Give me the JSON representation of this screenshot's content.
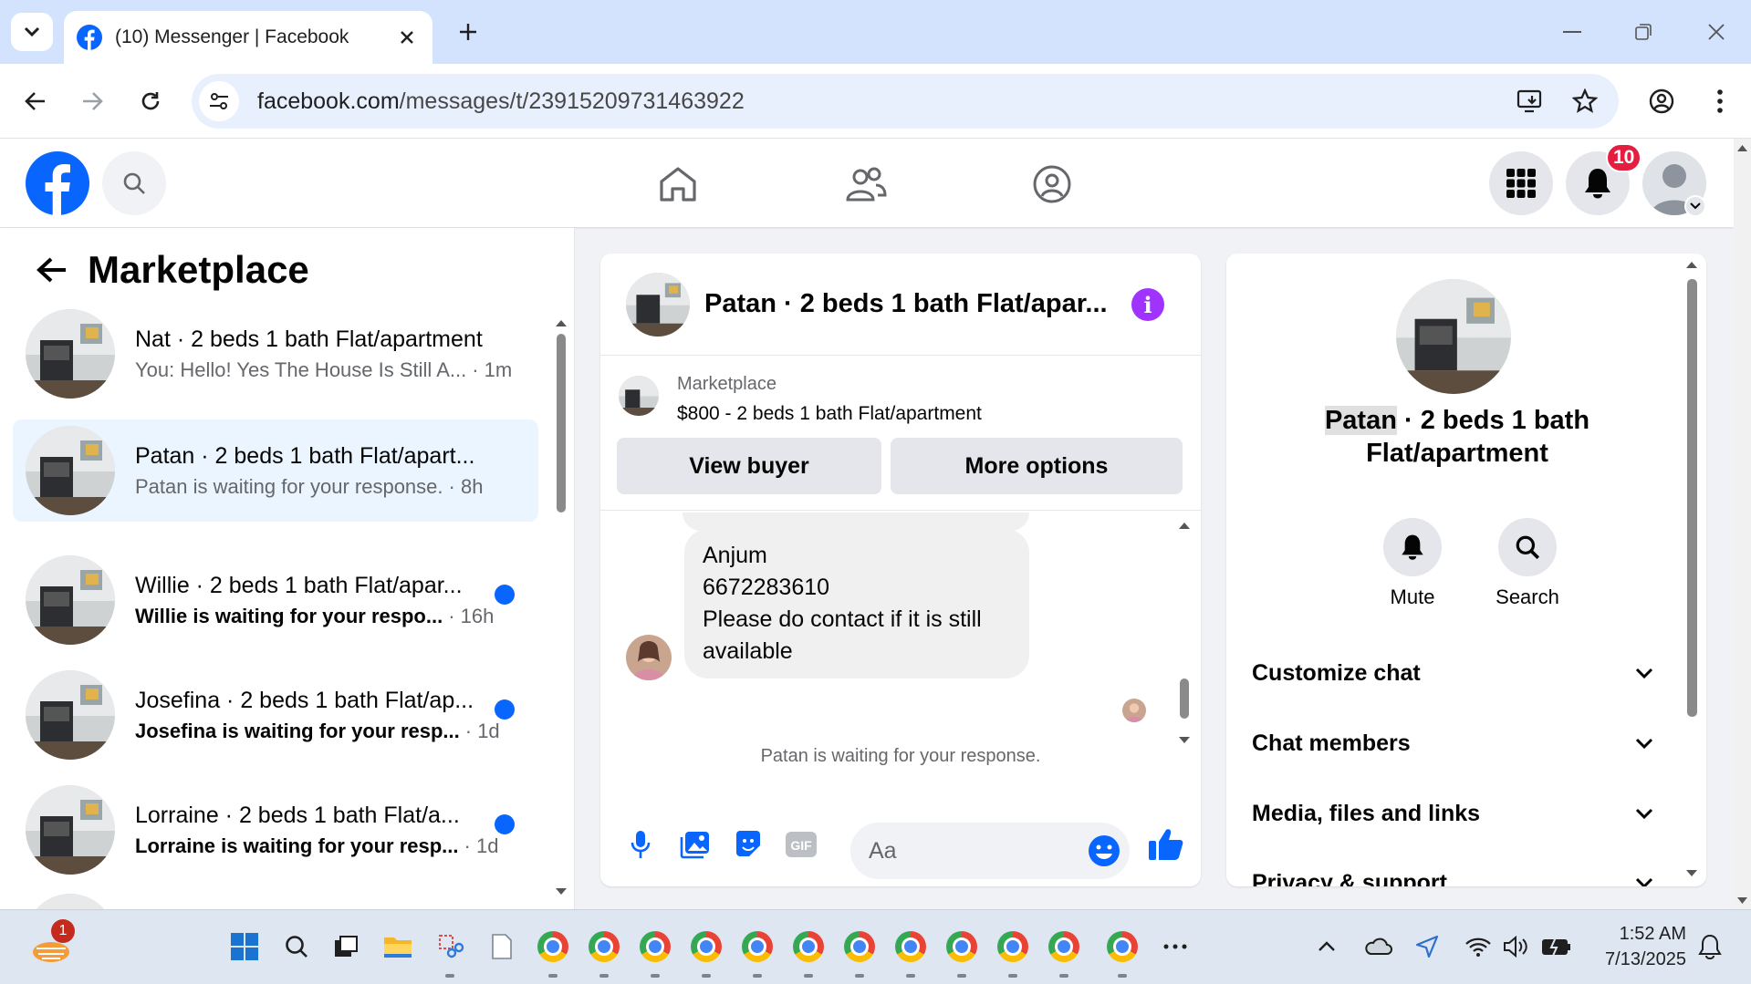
{
  "browser": {
    "tab_title": "(10) Messenger | Facebook",
    "url_host": "facebook.com",
    "url_path": "/messages/t/23915209731463922"
  },
  "fb_header": {
    "notification_count": "10"
  },
  "left_panel": {
    "title": "Marketplace",
    "conversations": [
      {
        "name": "Nat · 2 beds 1 bath Flat/apartment",
        "preview": "You: Hello! Yes The House Is Still A...",
        "time": "· 1m",
        "unread": false,
        "active": false
      },
      {
        "name": "Patan · 2 beds 1 bath Flat/apart...",
        "preview": "Patan is waiting for your response.",
        "time": "· 8h",
        "unread": false,
        "active": true
      },
      {
        "name": "Willie · 2 beds 1 bath Flat/apar...",
        "preview": "Willie is waiting for your respo...",
        "time": "· 16h",
        "unread": true,
        "active": false
      },
      {
        "name": "Josefina · 2 beds 1 bath Flat/ap...",
        "preview": "Josefina is waiting for your resp...",
        "time": "· 1d",
        "unread": true,
        "active": false
      },
      {
        "name": "Lorraine · 2 beds 1 bath Flat/a...",
        "preview": "Lorraine is waiting for your resp...",
        "time": "· 1d",
        "unread": true,
        "active": false
      }
    ]
  },
  "chat": {
    "title": "Patan · 2 beds 1 bath Flat/apar...",
    "listing_label": "Marketplace",
    "listing_price": "$800 - 2 beds 1 bath Flat/apartment",
    "view_buyer_label": "View buyer",
    "more_options_label": "More options",
    "message_lines": [
      "Anjum",
      "6672283610",
      "Please do contact if it is still",
      "available"
    ],
    "waiting_text": "Patan is waiting for your response.",
    "input_placeholder": "Aa"
  },
  "info_panel": {
    "title_name": "Patan",
    "title_line1_rest": " · 2 beds 1 bath",
    "title_line2": "Flat/apartment",
    "mute_label": "Mute",
    "search_label": "Search",
    "sections": [
      "Customize chat",
      "Chat members",
      "Media, files and links",
      "Privacy & support"
    ]
  },
  "taskbar": {
    "widget_badge": "1",
    "time": "1:52 AM",
    "date": "7/13/2025"
  },
  "colors": {
    "fb_blue": "#0866ff",
    "active_conv_bg": "#ebf5ff",
    "badge_red": "#e41e3f",
    "info_purple": "#a033ff"
  }
}
